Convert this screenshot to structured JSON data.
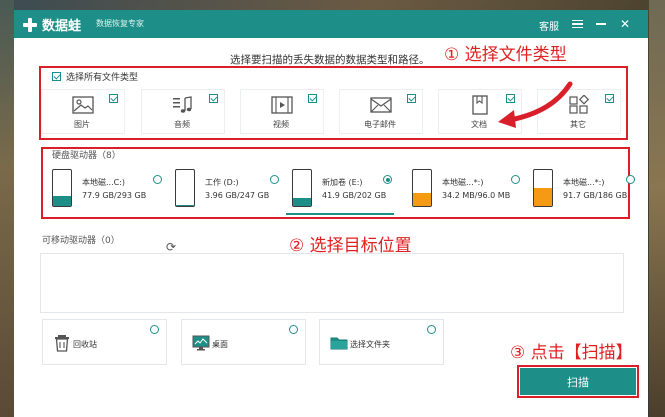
{
  "window": {
    "app_name": "数据蛙",
    "app_subtitle": "数据恢复专家",
    "service_label": "客服"
  },
  "instruction": "选择要扫描的丢失数据的数据类型和路径。",
  "annotations": {
    "step1": "① 选择文件类型",
    "step2": "② 选择目标位置",
    "step3": "③ 点击【扫描】"
  },
  "file_types": {
    "select_all_label": "选择所有文件类型",
    "select_all_checked": true,
    "items": [
      {
        "label": "图片",
        "icon": "image-icon",
        "checked": true
      },
      {
        "label": "音频",
        "icon": "music-icon",
        "checked": true
      },
      {
        "label": "视频",
        "icon": "video-icon",
        "checked": true
      },
      {
        "label": "电子邮件",
        "icon": "email-icon",
        "checked": true
      },
      {
        "label": "文档",
        "icon": "document-icon",
        "checked": true
      },
      {
        "label": "其它",
        "icon": "other-icon",
        "checked": true
      }
    ]
  },
  "hard_drives": {
    "title": "硬盘驱动器（8）",
    "items": [
      {
        "name": "本地磁...C:)",
        "size": "77.9 GB/293 GB",
        "used_fraction": 0.27,
        "fill_color": "#1d8f88",
        "selected": false
      },
      {
        "name": "工作 (D:)",
        "size": "3.96 GB/247 GB",
        "used_fraction": 0.02,
        "fill_color": "#1d8f88",
        "selected": false
      },
      {
        "name": "新加卷 (E:)",
        "size": "41.9 GB/202 GB",
        "used_fraction": 0.21,
        "fill_color": "#1d8f88",
        "selected": true
      },
      {
        "name": "本地磁...*:)",
        "size": "34.2 MB/96.0 MB",
        "used_fraction": 0.36,
        "fill_color": "#f59a12",
        "selected": false
      },
      {
        "name": "本地磁...*:)",
        "size": "91.7 GB/186 GB",
        "used_fraction": 0.49,
        "fill_color": "#f59a12",
        "selected": false
      }
    ]
  },
  "removable": {
    "title": "可移动驱动器（0）"
  },
  "locations": [
    {
      "label": "回收站",
      "icon": "recycle-bin-icon"
    },
    {
      "label": "桌面",
      "icon": "desktop-icon"
    },
    {
      "label": "选择文件夹",
      "icon": "folder-icon"
    }
  ],
  "scan_button": "扫描",
  "colors": {
    "accent": "#1d8f88",
    "annotation": "#e02020",
    "warning_drive": "#f59a12"
  }
}
